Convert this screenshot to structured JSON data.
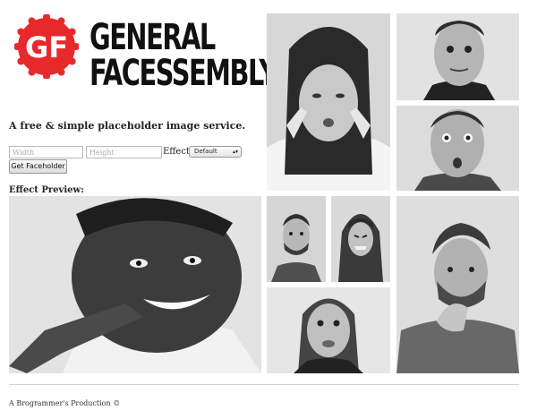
{
  "brand": {
    "logo_letters": "GF",
    "line1": "GENERAL",
    "line2": "FACESSEMBLY",
    "accent_color": "#e8292c"
  },
  "tagline": "A free & simple placeholder image service.",
  "form": {
    "width_placeholder": "Width",
    "height_placeholder": "Height",
    "effect_label": "Effect:",
    "effect_selected": "Default",
    "submit_label": "Get Faceholder"
  },
  "preview_heading": "Effect Preview:",
  "footer": "A Brogrammer's Production ©",
  "photos": [
    {
      "name": "photo-woman-cheeks-pushed"
    },
    {
      "name": "photo-man-crossed-eyes"
    },
    {
      "name": "photo-man-surprised"
    },
    {
      "name": "photo-man-smiling-pointing"
    },
    {
      "name": "photo-man-bearded-smiling"
    },
    {
      "name": "photo-woman-grimace"
    },
    {
      "name": "photo-man-thinking"
    },
    {
      "name": "photo-woman-funny-face"
    }
  ]
}
